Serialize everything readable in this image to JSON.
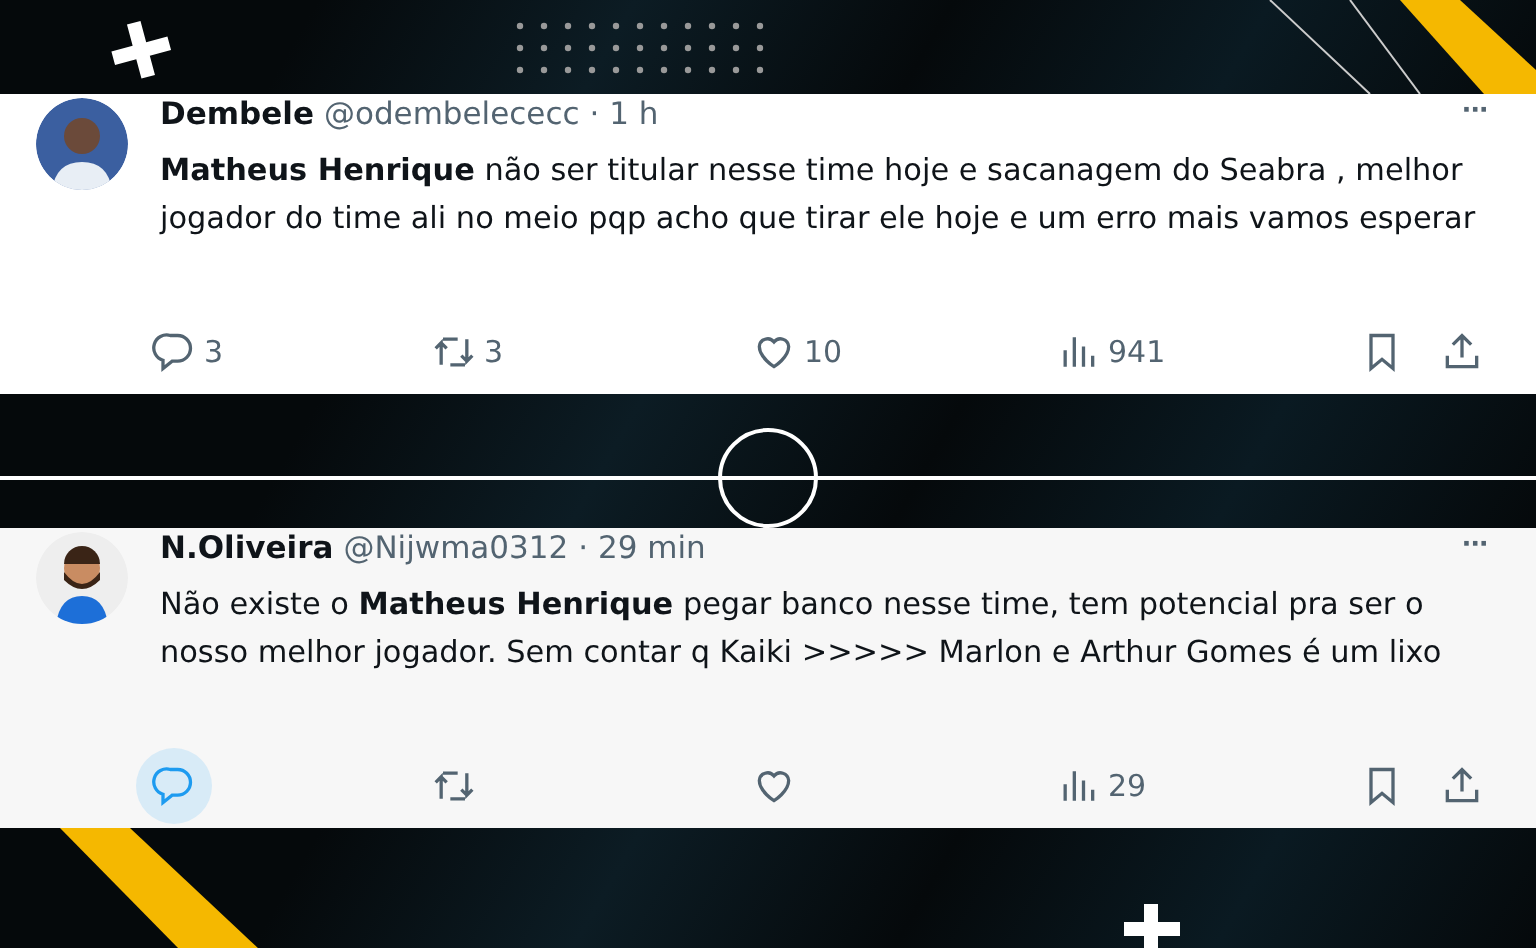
{
  "tweets": [
    {
      "name": "Dembele",
      "handle": "@odembelececc",
      "time": "· 1 h",
      "text": "**Matheus Henrique** não ser titular nesse time hoje e sacanagem do Seabra , melhor jogador do time ali no meio pqp acho que tirar ele hoje e um erro mais vamos esperar",
      "more": "···",
      "actions": [
        {
          "kind": "reply",
          "count": "3",
          "selected": false
        },
        {
          "kind": "repost",
          "count": "3",
          "selected": false
        },
        {
          "kind": "like",
          "count": "10",
          "selected": false
        },
        {
          "kind": "views",
          "count": "941",
          "selected": false
        },
        {
          "kind": "bookmark",
          "selected": false
        },
        {
          "kind": "share",
          "selected": false
        }
      ]
    },
    {
      "name": "N.Oliveira",
      "handle": "@Nijwma0312",
      "time": "· 29 min",
      "text": "Não existe o **Matheus Henrique** pegar banco nesse time, tem potencial pra ser o nosso melhor jogador. Sem contar q Kaiki >>>>> Marlon e Arthur Gomes é um lixo",
      "more": "···",
      "actions": [
        {
          "kind": "reply",
          "selected": true
        },
        {
          "kind": "repost",
          "selected": false
        },
        {
          "kind": "like",
          "selected": false
        },
        {
          "kind": "views",
          "count": "29",
          "selected": false
        },
        {
          "kind": "bookmark",
          "selected": false
        },
        {
          "kind": "share",
          "selected": false
        }
      ]
    }
  ]
}
